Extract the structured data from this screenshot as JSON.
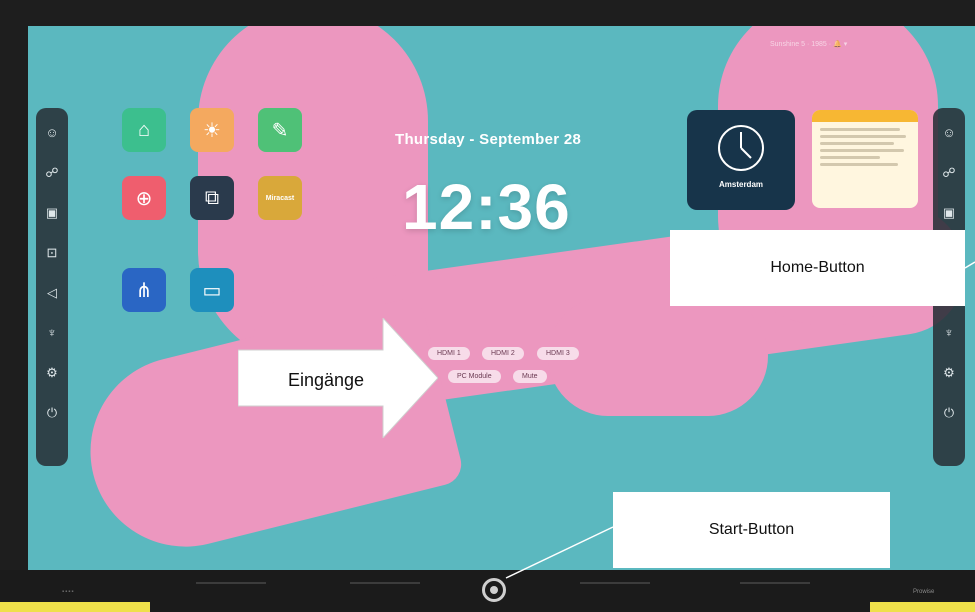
{
  "screen": {
    "date": "Thursday - September 28",
    "time": "12:36",
    "colors": {
      "background": "#5bb8bf",
      "accent_shape": "#ec97bf"
    }
  },
  "topbar": {
    "status": "Sunshine 5 · 1985 · 🔔 ▾"
  },
  "left_sidebar": {
    "items": [
      {
        "icon": "user-icon"
      },
      {
        "icon": "people-icon"
      },
      {
        "icon": "windows-icon"
      },
      {
        "icon": "input-icon"
      },
      {
        "icon": "volume-icon"
      },
      {
        "icon": "pen-icon"
      },
      {
        "icon": "settings-icon"
      },
      {
        "icon": "power-icon"
      }
    ]
  },
  "right_sidebar": {
    "items": [
      {
        "icon": "user-icon"
      },
      {
        "icon": "people-icon"
      },
      {
        "icon": "windows-icon"
      },
      {
        "icon": "input-icon"
      },
      {
        "icon": "volume-icon"
      },
      {
        "icon": "pen-icon"
      },
      {
        "icon": "settings-icon"
      },
      {
        "icon": "power-icon"
      }
    ]
  },
  "apps": [
    {
      "icon": "bag-icon",
      "color": "#3cbf8e"
    },
    {
      "icon": "bulb-icon",
      "color": "#f4a95f"
    },
    {
      "icon": "whiteboard-icon",
      "color": "#4fc177"
    },
    {
      "icon": "globe-icon",
      "color": "#ef5e6e"
    },
    {
      "icon": "screenshare-icon",
      "color": "#2a3a4c"
    },
    {
      "icon": "miracast-icon",
      "color": "#d9a83a",
      "text": "Miracast"
    },
    {
      "icon": "annotate-icon",
      "color": "#2a66c4"
    },
    {
      "icon": "folder-icon",
      "color": "#1e8fbd"
    }
  ],
  "inputs": {
    "hdmi1": "HDMI 1",
    "hdmi2": "HDMI 2",
    "hdmi3": "HDMI 3",
    "pc_module": "PC Module",
    "mute": "Mute"
  },
  "widgets": {
    "clock_city": "Amsterdam"
  },
  "bezel": {
    "brand": "Prowise",
    "start_icon": "power-ring-icon"
  },
  "callouts": {
    "inputs_label": "Eingänge",
    "home_label": "Home-Button",
    "start_label": "Start-Button"
  }
}
